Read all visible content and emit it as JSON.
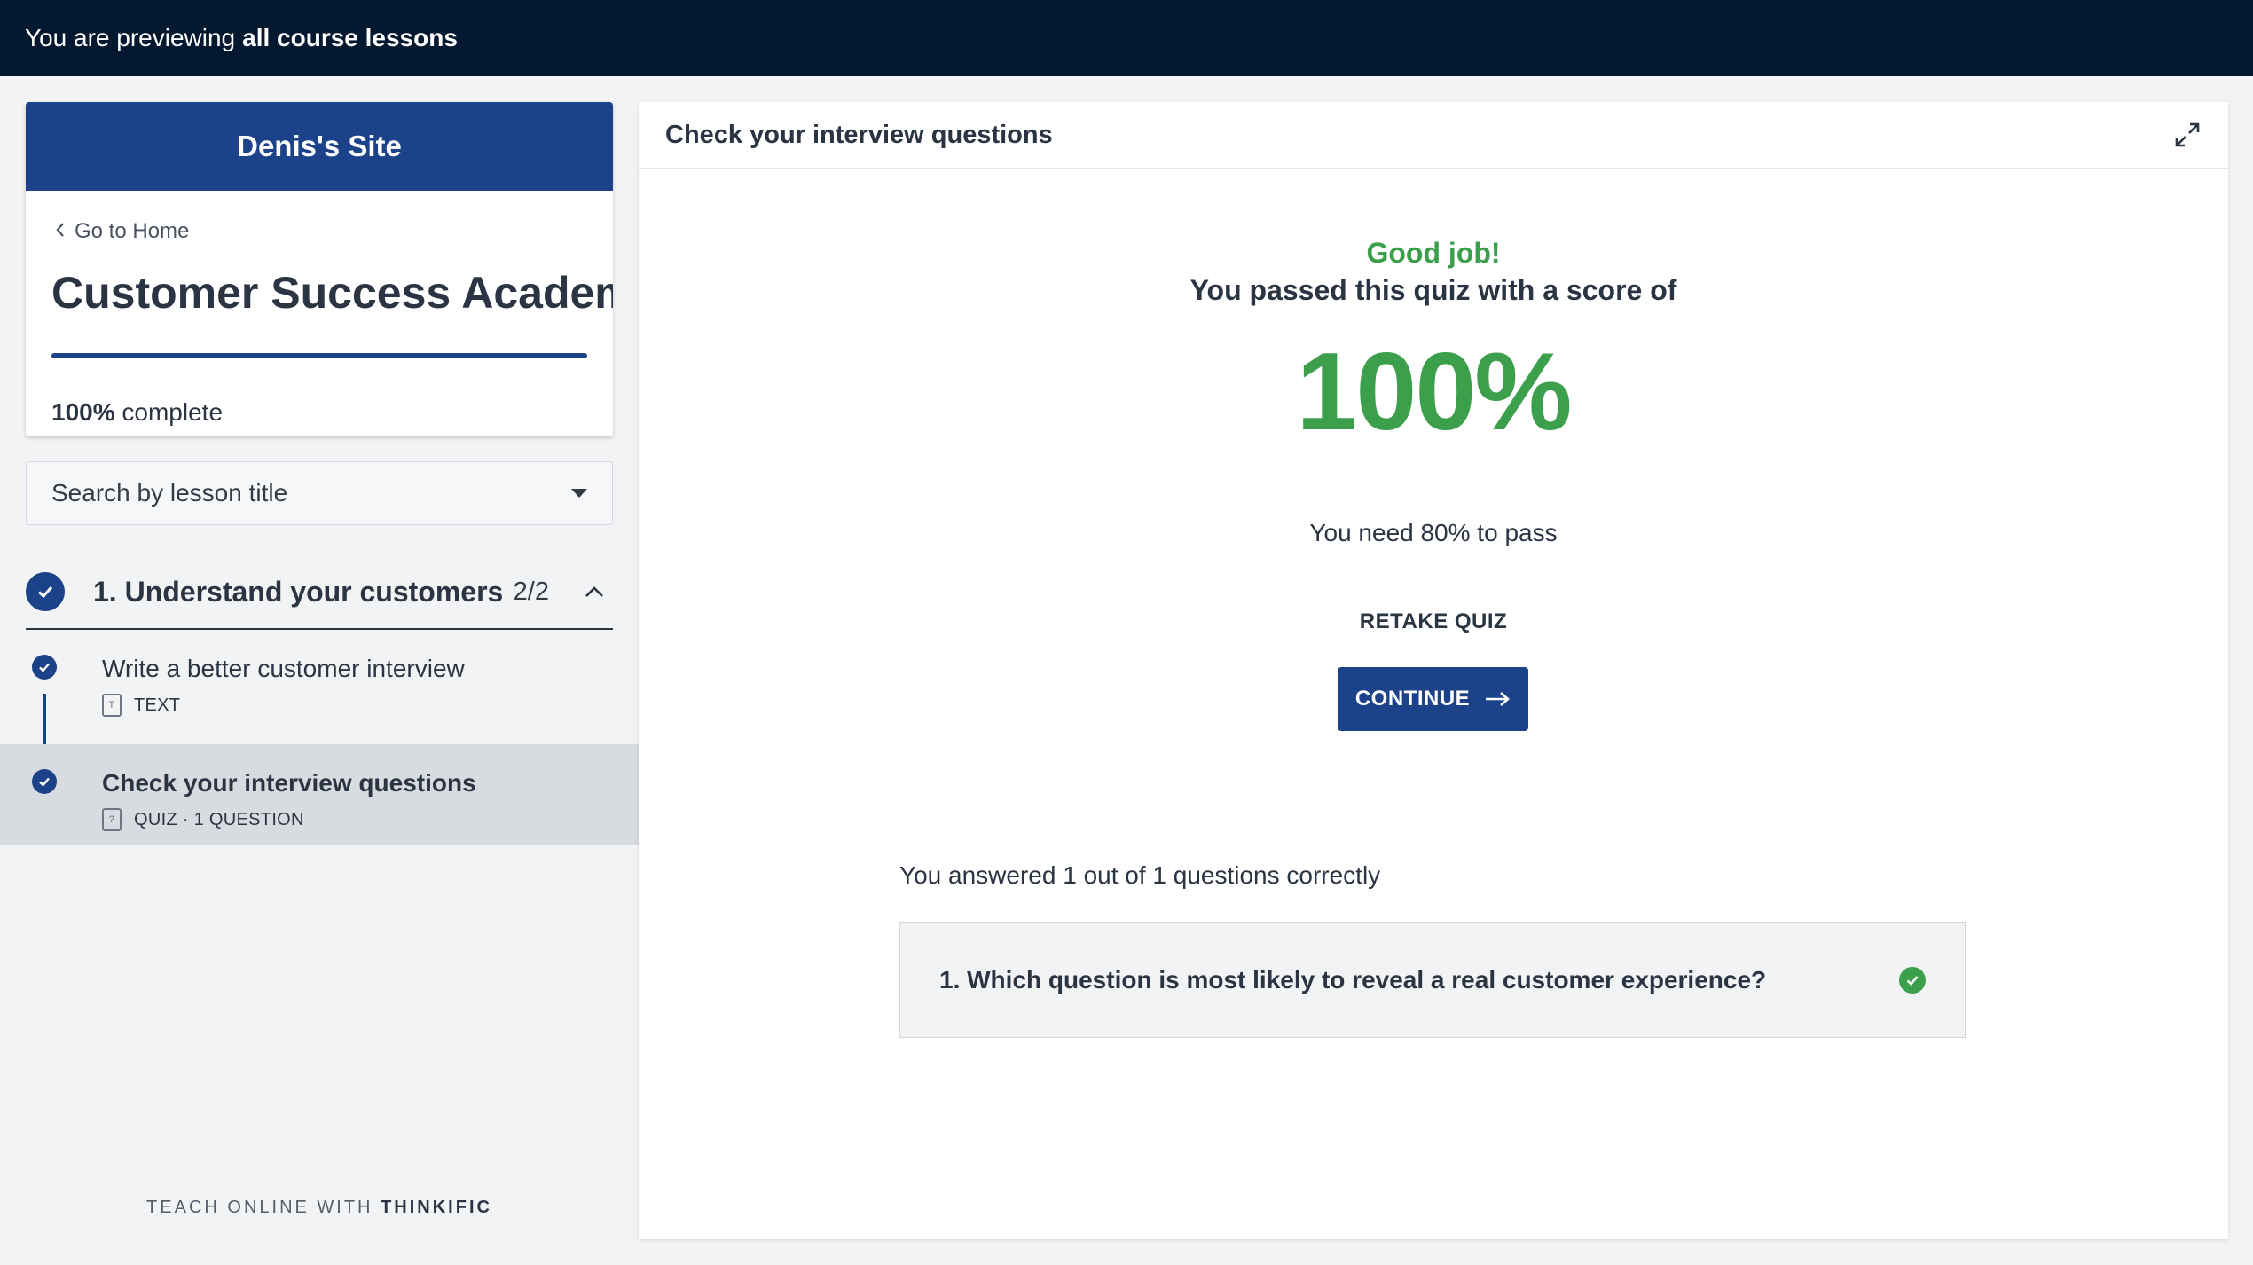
{
  "preview_bar": {
    "prefix": "You are previewing",
    "emphasis": "all course lessons"
  },
  "sidebar": {
    "site_name": "Denis's Site",
    "go_home": "Go to Home",
    "course_title": "Customer Success Academy",
    "progress": {
      "percent_label": "100%",
      "suffix": "complete",
      "value": 1.0
    },
    "search": {
      "placeholder": "Search by lesson title"
    },
    "chapter": {
      "title": "1. Understand your customers",
      "count": "2/2"
    },
    "lessons": [
      {
        "title": "Write a better customer interview",
        "meta": "TEXT",
        "icon": "text-lesson-icon",
        "completed": true
      },
      {
        "title": "Check your interview questions",
        "meta": "QUIZ · 1 QUESTION",
        "icon": "quiz-lesson-icon",
        "completed": true
      }
    ],
    "footer": {
      "prefix": "TEACH ONLINE WITH",
      "brand": "THINKIFIC"
    }
  },
  "main": {
    "title": "Check your interview questions",
    "result": {
      "headline": "Good job!",
      "subline": "You passed this quiz with a score of",
      "score": "100%",
      "requirement": "You need 80% to pass",
      "retake_label": "RETAKE QUIZ",
      "continue_label": "CONTINUE",
      "summary": "You answered 1 out of 1 questions correctly"
    },
    "questions": [
      {
        "text": "1. Which question is most likely to reveal a real customer experience?",
        "correct": true
      }
    ]
  },
  "colors": {
    "topbar": "#04192f",
    "brand_blue": "#1c4289",
    "success_green": "#3c9f4b",
    "text": "#2b3443"
  }
}
